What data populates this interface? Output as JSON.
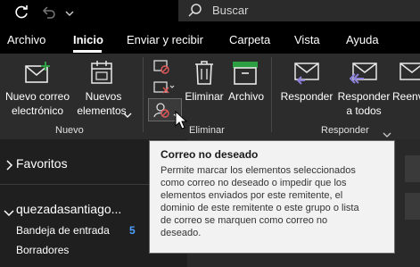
{
  "titlebar": {
    "search_placeholder": "Buscar"
  },
  "tabs": [
    {
      "label": "Archivo",
      "active": false
    },
    {
      "label": "Inicio",
      "active": true
    },
    {
      "label": "Enviar y recibir",
      "active": false
    },
    {
      "label": "Carpeta",
      "active": false
    },
    {
      "label": "Vista",
      "active": false
    },
    {
      "label": "Ayuda",
      "active": false
    }
  ],
  "ribbon": {
    "new_email_line1": "Nuevo correo",
    "new_email_line2": "electrónico",
    "new_items_line1": "Nuevos",
    "new_items_line2": "elementos",
    "group_new": "Nuevo",
    "delete": "Eliminar",
    "archive": "Archivo",
    "group_delete": "Eliminar",
    "reply": "Responder",
    "reply_all_line1": "Responder",
    "reply_all_line2": "a todos",
    "forward_partial": "Reenv",
    "group_respond": "Responder"
  },
  "folders": {
    "favorites": "Favoritos",
    "account": "quezadasantiago...",
    "inbox": "Bandeja de entrada",
    "inbox_count": "5",
    "drafts": "Borradores"
  },
  "tooltip": {
    "title": "Correo no deseado",
    "body": "Permite marcar los elementos seleccionados\ncomo correo no deseado o impedir que los\nelementos enviados por este remitente, el\ndominio de este remitente o este grupo o lista\nde correo se marquen como correo no\ndeseado."
  },
  "colors": {
    "accent_green": "#2ea043",
    "accent_purple": "#8b7fd8",
    "badge_blue": "#4ea1ff",
    "danger_red": "#e05a5a"
  }
}
